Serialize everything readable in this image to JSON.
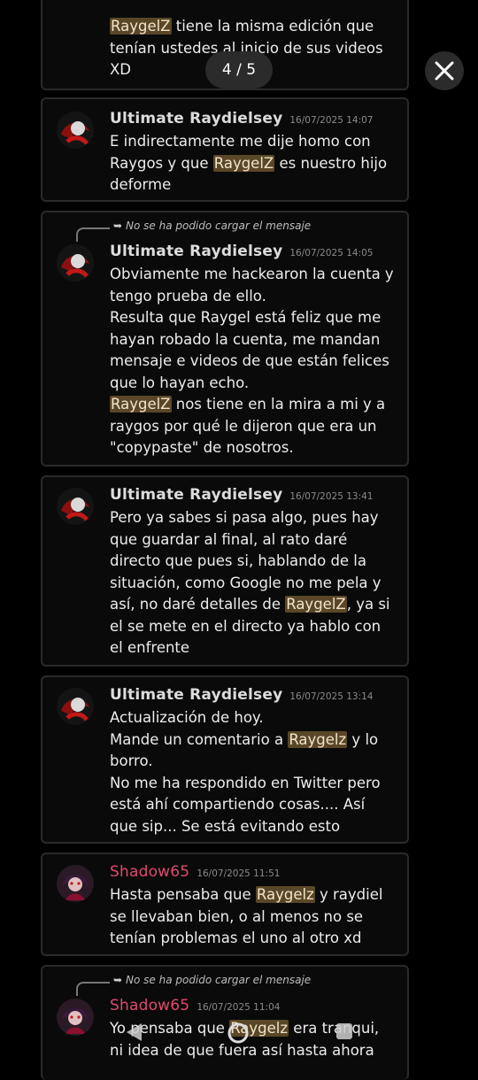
{
  "viewer": {
    "counter": "4 / 5",
    "close_icon": "close-icon"
  },
  "messages": [
    {
      "partial": true,
      "text_parts": [
        {
          "mention": "RaygelZ"
        },
        {
          "text": " tiene la misma edición que tenían ustedes al inicio de sus videos XD"
        }
      ]
    },
    {
      "author": "Ultimate Raydielsey",
      "timestamp": "16/07/2025 14:07",
      "text_parts": [
        {
          "text": "E indirectamente me dije homo con Raygos y que "
        },
        {
          "mention": "RaygelZ"
        },
        {
          "text": " es nuestro hijo deforme"
        }
      ]
    },
    {
      "reply_note": "No se ha podido cargar el mensaje",
      "author": "Ultimate Raydielsey",
      "timestamp": "16/07/2025 14:05",
      "text_parts": [
        {
          "text": "Obviamente me hackearon la cuenta y tengo prueba de ello."
        },
        {
          "text": "Resulta que Raygel está feliz que me hayan robado la cuenta, me mandan mensaje e videos de que están felices que lo hayan echo."
        },
        {
          "mention": "RaygelZ"
        },
        {
          "text": " nos tiene en la mira a mi y a raygos por qué le dijeron que era un \"copypaste\" de nosotros."
        }
      ]
    },
    {
      "author": "Ultimate Raydielsey",
      "timestamp": "16/07/2025 13:41",
      "text_parts": [
        {
          "text": "Pero ya sabes si pasa algo, pues hay que guardar al final, al rato daré directo que pues si, hablando de la situación, como Google no me pela y así, no daré detalles de "
        },
        {
          "mention": "RaygelZ"
        },
        {
          "text": ", ya si el se mete en el directo ya hablo con el enfrente"
        }
      ]
    },
    {
      "author": "Ultimate Raydielsey",
      "timestamp": "16/07/2025 13:14",
      "text_parts": [
        {
          "text": "Actualización de hoy."
        },
        {
          "text": "Mande un comentario a "
        },
        {
          "mention": "Raygelz"
        },
        {
          "text": " y lo borro."
        },
        {
          "text": "No me ha respondido en Twitter pero está ahí compartiendo cosas.... Así que sip... Se está evitando esto"
        }
      ]
    },
    {
      "author": "Shadow65",
      "timestamp": "16/07/2025 11:51",
      "text_parts": [
        {
          "text": "Hasta pensaba que "
        },
        {
          "mention": "Raygelz"
        },
        {
          "text": " y raydiel se llevaban bien, o al menos no se tenían problemas el uno al otro xd"
        }
      ]
    },
    {
      "reply_note": "No se ha podido cargar el mensaje",
      "author": "Shadow65",
      "timestamp": "16/07/2025 11:04",
      "text_parts": [
        {
          "text": "Yo pensaba que "
        },
        {
          "mention": "Raygelz"
        },
        {
          "text": " era tranqui, ni idea de que fuera así hasta ahora"
        }
      ]
    }
  ],
  "nav": {
    "back_icon": "back-triangle-icon",
    "home_icon": "home-circle-icon",
    "recents_icon": "recents-square-icon"
  },
  "colors": {
    "background": "#000000",
    "card": "#0a0a0a",
    "card_border": "#2a2a2a",
    "mention_bg": "#5a4727",
    "shadow_name": "#e04a6c"
  }
}
